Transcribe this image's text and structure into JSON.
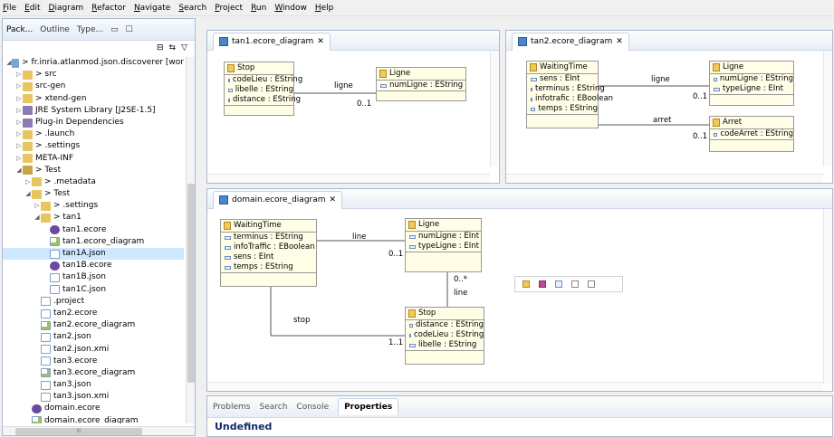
{
  "menu": [
    "File",
    "Edit",
    "Diagram",
    "Refactor",
    "Navigate",
    "Search",
    "Project",
    "Run",
    "Window",
    "Help"
  ],
  "explorer": {
    "tabs": [
      "Pack...",
      "Outline",
      "Type..."
    ],
    "tree": [
      {
        "indent": 0,
        "tri": "◢",
        "icon": "proj",
        "label": "> fr.inria.atlanmod.json.discoverer [wor"
      },
      {
        "indent": 1,
        "tri": "▷",
        "icon": "folder",
        "label": "> src"
      },
      {
        "indent": 1,
        "tri": "▷",
        "icon": "folder",
        "label": "src-gen"
      },
      {
        "indent": 1,
        "tri": "▷",
        "icon": "folder",
        "label": "> xtend-gen"
      },
      {
        "indent": 1,
        "tri": "▷",
        "icon": "lib",
        "label": "JRE System Library [J2SE-1.5]"
      },
      {
        "indent": 1,
        "tri": "▷",
        "icon": "lib",
        "label": "Plug-in Dependencies"
      },
      {
        "indent": 1,
        "tri": "▷",
        "icon": "folder",
        "label": "> .launch"
      },
      {
        "indent": 1,
        "tri": "▷",
        "icon": "folder",
        "label": "> .settings"
      },
      {
        "indent": 1,
        "tri": "▷",
        "icon": "folder",
        "label": "META-INF"
      },
      {
        "indent": 1,
        "tri": "◢",
        "icon": "pkg",
        "label": "> Test"
      },
      {
        "indent": 2,
        "tri": "▷",
        "icon": "folder",
        "label": "> .metadata"
      },
      {
        "indent": 2,
        "tri": "◢",
        "icon": "folder",
        "label": "> Test"
      },
      {
        "indent": 3,
        "tri": "▷",
        "icon": "folder",
        "label": "> .settings"
      },
      {
        "indent": 3,
        "tri": "◢",
        "icon": "folder",
        "label": "> tan1"
      },
      {
        "indent": 4,
        "tri": "",
        "icon": "ecore",
        "label": "tan1.ecore"
      },
      {
        "indent": 4,
        "tri": "",
        "icon": "diagram",
        "label": "tan1.ecore_diagram"
      },
      {
        "indent": 4,
        "tri": "",
        "icon": "file",
        "label": "tan1A.json",
        "selected": true
      },
      {
        "indent": 4,
        "tri": "",
        "icon": "ecore",
        "label": "tan1B.ecore"
      },
      {
        "indent": 4,
        "tri": "",
        "icon": "file",
        "label": "tan1B.json"
      },
      {
        "indent": 4,
        "tri": "",
        "icon": "file",
        "label": "tan1C.json"
      },
      {
        "indent": 3,
        "tri": "",
        "icon": "xmi",
        "label": ".project"
      },
      {
        "indent": 3,
        "tri": "",
        "icon": "file",
        "label": "tan2.ecore"
      },
      {
        "indent": 3,
        "tri": "",
        "icon": "diagram",
        "label": "tan2.ecore_diagram"
      },
      {
        "indent": 3,
        "tri": "",
        "icon": "file",
        "label": "tan2.json"
      },
      {
        "indent": 3,
        "tri": "",
        "icon": "file",
        "label": "tan2.json.xmi"
      },
      {
        "indent": 3,
        "tri": "",
        "icon": "file",
        "label": "tan3.ecore"
      },
      {
        "indent": 3,
        "tri": "",
        "icon": "diagram",
        "label": "tan3.ecore_diagram"
      },
      {
        "indent": 3,
        "tri": "",
        "icon": "file",
        "label": "tan3.json"
      },
      {
        "indent": 3,
        "tri": "",
        "icon": "xmi",
        "label": "tan3.json.xmi"
      },
      {
        "indent": 2,
        "tri": "",
        "icon": "ecore",
        "label": "domain.ecore"
      },
      {
        "indent": 2,
        "tri": "",
        "icon": "diagram",
        "label": "domain.ecore_diagram"
      }
    ],
    "hscroll_glyph": "III"
  },
  "editors": {
    "tan1": {
      "tab": "tan1.ecore_diagram"
    },
    "tan2": {
      "tab": "tan2.ecore_diagram"
    },
    "domain": {
      "tab": "domain.ecore_diagram"
    }
  },
  "classes": {
    "tan1_stop": {
      "name": "Stop",
      "attrs": [
        "codeLieu : EString",
        "libelle : EString",
        "distance : EString"
      ]
    },
    "tan1_ligne": {
      "name": "Ligne",
      "attrs": [
        "numLigne : EString"
      ]
    },
    "tan2_wt": {
      "name": "WaitingTime",
      "attrs": [
        "sens : EInt",
        "terminus : EString",
        "infotrafic : EBoolean",
        "temps : EString"
      ]
    },
    "tan2_ligne": {
      "name": "Ligne",
      "attrs": [
        "numLigne : EString",
        "typeLigne : EInt"
      ]
    },
    "tan2_arret": {
      "name": "Arret",
      "attrs": [
        "codeArret : EString"
      ]
    },
    "dom_wt": {
      "name": "WaitingTime",
      "attrs": [
        "terminus : EString",
        "infoTraffic : EBoolean",
        "sens : EInt",
        "temps : EString"
      ]
    },
    "dom_ligne": {
      "name": "Ligne",
      "attrs": [
        "numLigne : EInt",
        "typeLigne : EInt"
      ]
    },
    "dom_stop": {
      "name": "Stop",
      "attrs": [
        "distance : EString",
        "codeLieu : EString",
        "libelle : EString"
      ]
    }
  },
  "edge_labels": {
    "tan1_ligne": "ligne",
    "tan1_mult": "0..1",
    "tan2_ligne": "ligne",
    "tan2_ligne_mult": "0..1",
    "tan2_arret": "arret",
    "tan2_arret_mult": "0..1",
    "dom_line": "line",
    "dom_line_mult": "0..1",
    "dom_line2": "line",
    "dom_line2_mult": "0..*",
    "dom_stop": "stop",
    "dom_stop_mult": "1..1"
  },
  "bottom": {
    "tabs": [
      "Problems",
      "Search",
      "Console",
      "Properties"
    ],
    "title": "Undefined"
  }
}
